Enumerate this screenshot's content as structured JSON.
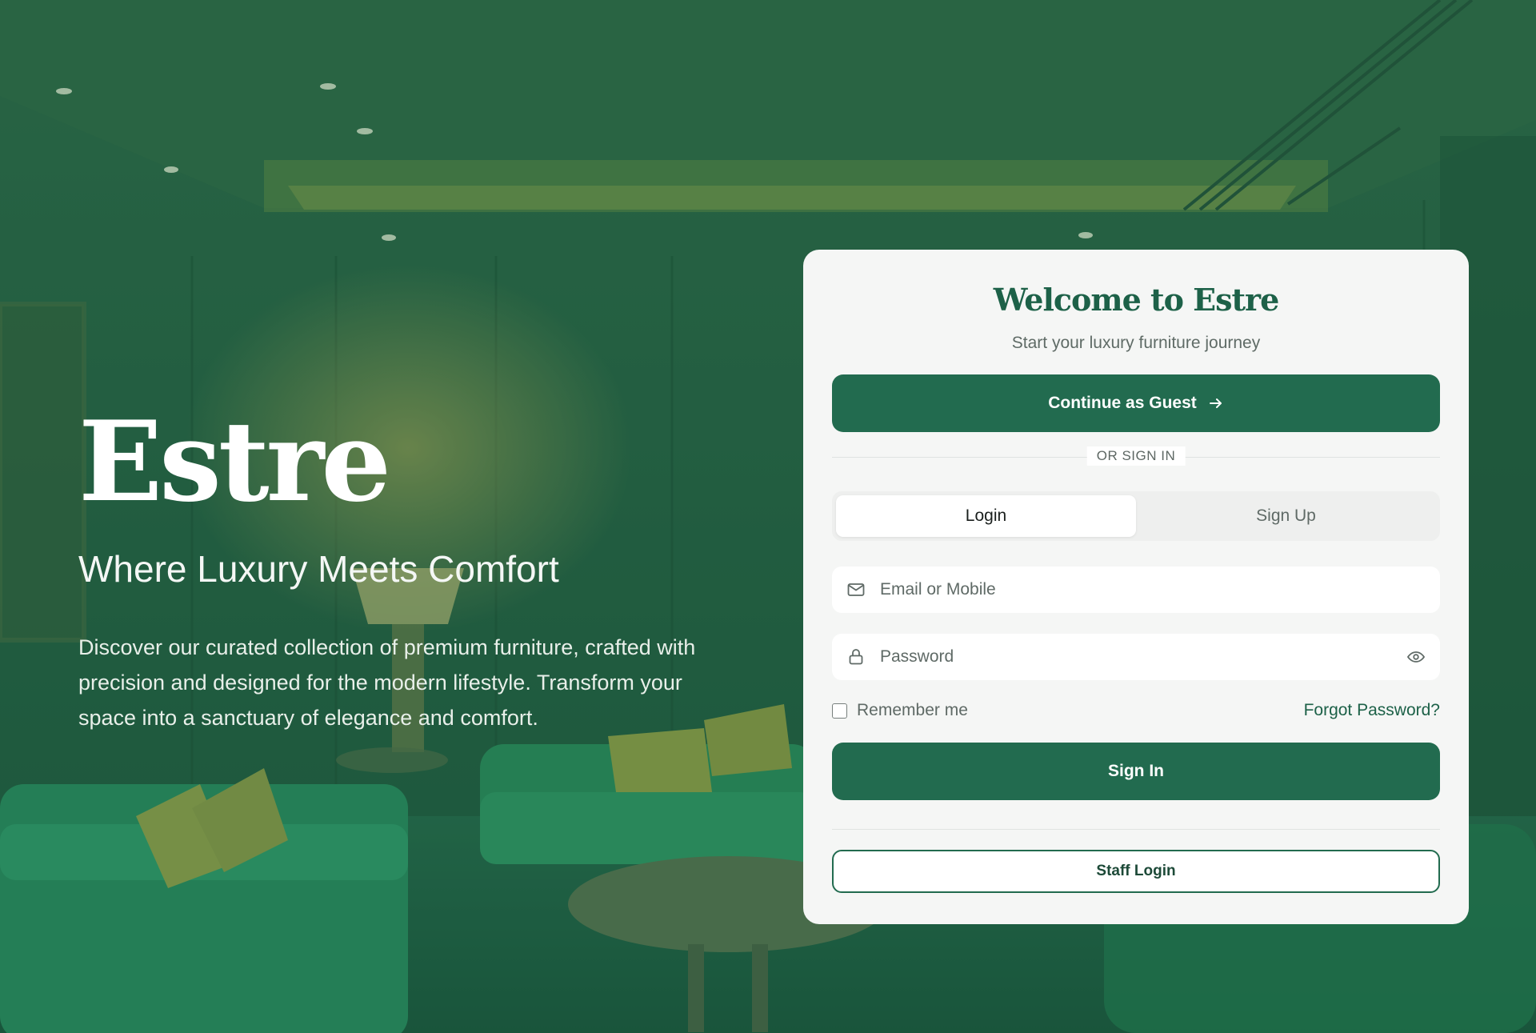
{
  "brand": {
    "name": "Estre",
    "tagline": "Where Luxury Meets Comfort",
    "description": "Discover our curated collection of premium furniture, crafted with precision and designed for the modern lifestyle. Transform your space into a sanctuary of elegance and comfort."
  },
  "card": {
    "title": "Welcome to Estre",
    "subtitle": "Start your luxury furniture journey",
    "guest_button": "Continue as Guest",
    "divider": "OR SIGN IN",
    "tabs": [
      {
        "label": "Login",
        "active": true
      },
      {
        "label": "Sign Up",
        "active": false
      }
    ],
    "email": {
      "placeholder": "Email or Mobile",
      "icon": "mail-icon"
    },
    "password": {
      "placeholder": "Password",
      "icon": "lock-icon",
      "toggle_icon": "eye-icon"
    },
    "remember_label": "Remember me",
    "forgot_label": "Forgot Password?",
    "signin_button": "Sign In",
    "staff_button": "Staff Login"
  },
  "colors": {
    "primary": "#226b4f",
    "title": "#1d6148",
    "overlay": "#1f5a40"
  }
}
